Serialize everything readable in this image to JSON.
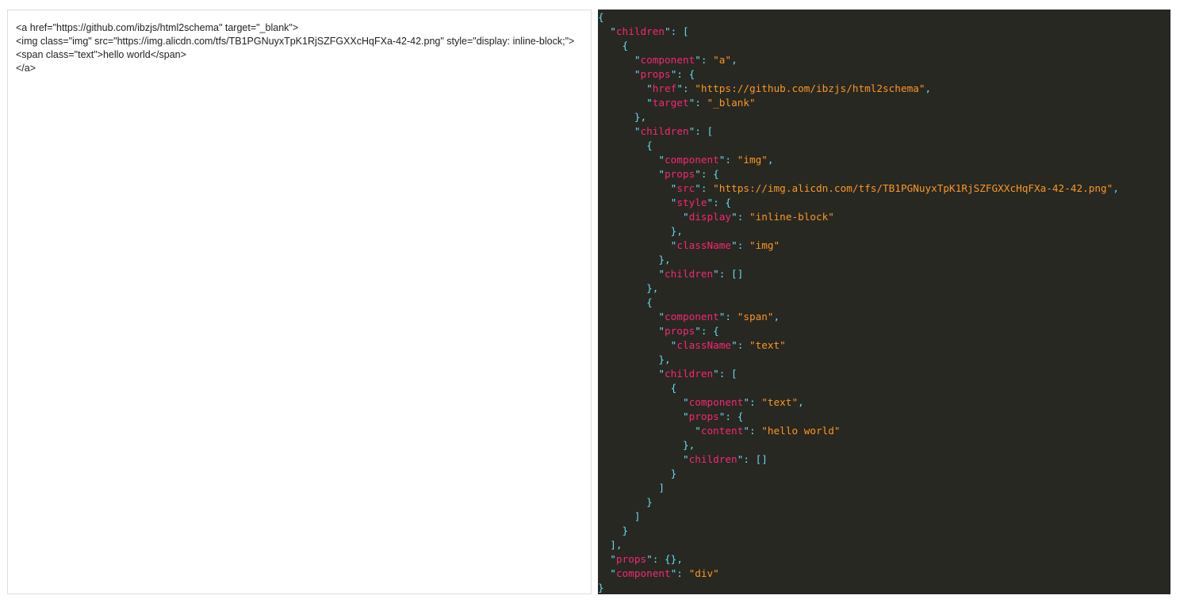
{
  "html_input": {
    "value": "<a href=\"https://github.com/ibzjs/html2schema\" target=\"_blank\">\n<img class=\"img\" src=\"https://img.alicdn.com/tfs/TB1PGNuyxTpK1RjSZFGXXcHqFXa-42-42.png\" style=\"display: inline-block;\">\n<span class=\"text\">hello world</span>\n</a>"
  },
  "json_output": {
    "colors": {
      "background": "#272822",
      "key": "#f92672",
      "string": "#fd971f",
      "punctuation": "#66d9ef"
    },
    "lines": [
      [
        {
          "t": "p",
          "v": "{"
        }
      ],
      [
        {
          "t": "p",
          "v": "  \""
        },
        {
          "t": "k",
          "v": "children"
        },
        {
          "t": "p",
          "v": "\": ["
        }
      ],
      [
        {
          "t": "p",
          "v": "    {"
        }
      ],
      [
        {
          "t": "p",
          "v": "      \""
        },
        {
          "t": "k",
          "v": "component"
        },
        {
          "t": "p",
          "v": "\": "
        },
        {
          "t": "s",
          "v": "\"a\""
        },
        {
          "t": "p",
          "v": ","
        }
      ],
      [
        {
          "t": "p",
          "v": "      \""
        },
        {
          "t": "k",
          "v": "props"
        },
        {
          "t": "p",
          "v": "\": {"
        }
      ],
      [
        {
          "t": "p",
          "v": "        \""
        },
        {
          "t": "k",
          "v": "href"
        },
        {
          "t": "p",
          "v": "\": "
        },
        {
          "t": "s",
          "v": "\"https://github.com/ibzjs/html2schema\""
        },
        {
          "t": "p",
          "v": ","
        }
      ],
      [
        {
          "t": "p",
          "v": "        \""
        },
        {
          "t": "k",
          "v": "target"
        },
        {
          "t": "p",
          "v": "\": "
        },
        {
          "t": "s",
          "v": "\"_blank\""
        }
      ],
      [
        {
          "t": "p",
          "v": "      },"
        }
      ],
      [
        {
          "t": "p",
          "v": "      \""
        },
        {
          "t": "k",
          "v": "children"
        },
        {
          "t": "p",
          "v": "\": ["
        }
      ],
      [
        {
          "t": "p",
          "v": "        {"
        }
      ],
      [
        {
          "t": "p",
          "v": "          \""
        },
        {
          "t": "k",
          "v": "component"
        },
        {
          "t": "p",
          "v": "\": "
        },
        {
          "t": "s",
          "v": "\"img\""
        },
        {
          "t": "p",
          "v": ","
        }
      ],
      [
        {
          "t": "p",
          "v": "          \""
        },
        {
          "t": "k",
          "v": "props"
        },
        {
          "t": "p",
          "v": "\": {"
        }
      ],
      [
        {
          "t": "p",
          "v": "            \""
        },
        {
          "t": "k",
          "v": "src"
        },
        {
          "t": "p",
          "v": "\": "
        },
        {
          "t": "s",
          "v": "\"https://img.alicdn.com/tfs/TB1PGNuyxTpK1RjSZFGXXcHqFXa-42-42.png\""
        },
        {
          "t": "p",
          "v": ","
        }
      ],
      [
        {
          "t": "p",
          "v": "            \""
        },
        {
          "t": "k",
          "v": "style"
        },
        {
          "t": "p",
          "v": "\": {"
        }
      ],
      [
        {
          "t": "p",
          "v": "              \""
        },
        {
          "t": "k",
          "v": "display"
        },
        {
          "t": "p",
          "v": "\": "
        },
        {
          "t": "s",
          "v": "\"inline-block\""
        }
      ],
      [
        {
          "t": "p",
          "v": "            },"
        }
      ],
      [
        {
          "t": "p",
          "v": "            \""
        },
        {
          "t": "k",
          "v": "className"
        },
        {
          "t": "p",
          "v": "\": "
        },
        {
          "t": "s",
          "v": "\"img\""
        }
      ],
      [
        {
          "t": "p",
          "v": "          },"
        }
      ],
      [
        {
          "t": "p",
          "v": "          \""
        },
        {
          "t": "k",
          "v": "children"
        },
        {
          "t": "p",
          "v": "\": []"
        }
      ],
      [
        {
          "t": "p",
          "v": "        },"
        }
      ],
      [
        {
          "t": "p",
          "v": "        {"
        }
      ],
      [
        {
          "t": "p",
          "v": "          \""
        },
        {
          "t": "k",
          "v": "component"
        },
        {
          "t": "p",
          "v": "\": "
        },
        {
          "t": "s",
          "v": "\"span\""
        },
        {
          "t": "p",
          "v": ","
        }
      ],
      [
        {
          "t": "p",
          "v": "          \""
        },
        {
          "t": "k",
          "v": "props"
        },
        {
          "t": "p",
          "v": "\": {"
        }
      ],
      [
        {
          "t": "p",
          "v": "            \""
        },
        {
          "t": "k",
          "v": "className"
        },
        {
          "t": "p",
          "v": "\": "
        },
        {
          "t": "s",
          "v": "\"text\""
        }
      ],
      [
        {
          "t": "p",
          "v": "          },"
        }
      ],
      [
        {
          "t": "p",
          "v": "          \""
        },
        {
          "t": "k",
          "v": "children"
        },
        {
          "t": "p",
          "v": "\": ["
        }
      ],
      [
        {
          "t": "p",
          "v": "            {"
        }
      ],
      [
        {
          "t": "p",
          "v": "              \""
        },
        {
          "t": "k",
          "v": "component"
        },
        {
          "t": "p",
          "v": "\": "
        },
        {
          "t": "s",
          "v": "\"text\""
        },
        {
          "t": "p",
          "v": ","
        }
      ],
      [
        {
          "t": "p",
          "v": "              \""
        },
        {
          "t": "k",
          "v": "props"
        },
        {
          "t": "p",
          "v": "\": {"
        }
      ],
      [
        {
          "t": "p",
          "v": "                \""
        },
        {
          "t": "k",
          "v": "content"
        },
        {
          "t": "p",
          "v": "\": "
        },
        {
          "t": "s",
          "v": "\"hello world\""
        }
      ],
      [
        {
          "t": "p",
          "v": "              },"
        }
      ],
      [
        {
          "t": "p",
          "v": "              \""
        },
        {
          "t": "k",
          "v": "children"
        },
        {
          "t": "p",
          "v": "\": []"
        }
      ],
      [
        {
          "t": "p",
          "v": "            }"
        }
      ],
      [
        {
          "t": "p",
          "v": "          ]"
        }
      ],
      [
        {
          "t": "p",
          "v": "        }"
        }
      ],
      [
        {
          "t": "p",
          "v": "      ]"
        }
      ],
      [
        {
          "t": "p",
          "v": "    }"
        }
      ],
      [
        {
          "t": "p",
          "v": "  ],"
        }
      ],
      [
        {
          "t": "p",
          "v": "  \""
        },
        {
          "t": "k",
          "v": "props"
        },
        {
          "t": "p",
          "v": "\": {},"
        }
      ],
      [
        {
          "t": "p",
          "v": "  \""
        },
        {
          "t": "k",
          "v": "component"
        },
        {
          "t": "p",
          "v": "\": "
        },
        {
          "t": "s",
          "v": "\"div\""
        }
      ],
      [
        {
          "t": "p",
          "v": "}"
        }
      ]
    ]
  }
}
